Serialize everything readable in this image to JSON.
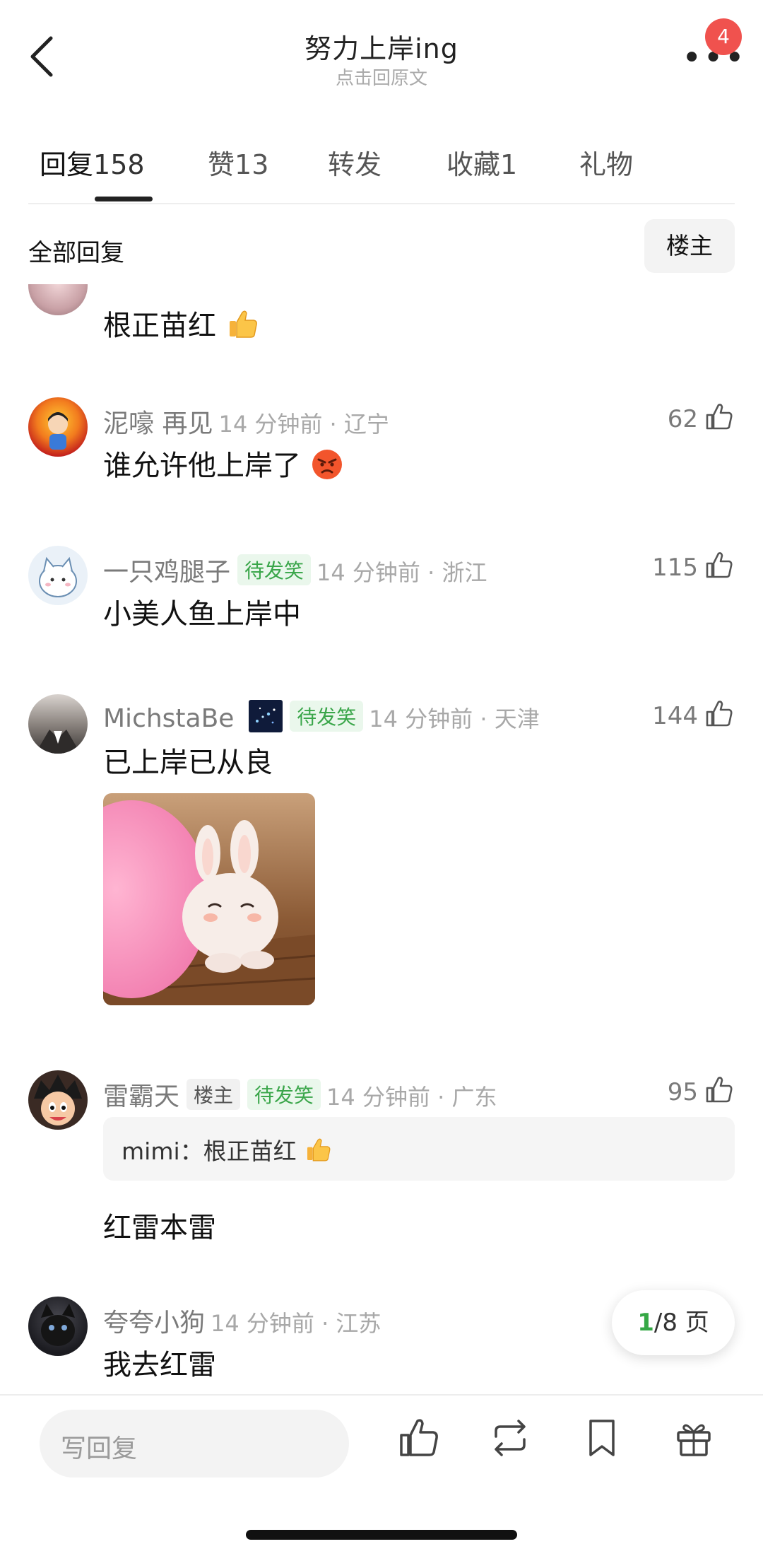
{
  "header": {
    "title": "努力上岸ing",
    "subtitle": "点击回原文",
    "notification_count": "4"
  },
  "tabs": [
    {
      "label": "回复",
      "count": "158"
    },
    {
      "label": "赞",
      "count": "13"
    },
    {
      "label": "转发",
      "count": ""
    },
    {
      "label": "收藏",
      "count": "1"
    },
    {
      "label": "礼物",
      "count": ""
    }
  ],
  "filter": {
    "label": "全部回复",
    "op_button": "楼主"
  },
  "comments": [
    {
      "username": "",
      "time_location": "",
      "text": "根正苗红",
      "emoji": "thumbs-up",
      "likes": ""
    },
    {
      "username": "泥嚎 再见",
      "time_location": "14 分钟前 · 辽宁",
      "text": "谁允许他上岸了",
      "emoji": "angry-face",
      "likes": "62"
    },
    {
      "username": "一只鸡腿子",
      "badge": "待发笑",
      "time_location": "14 分钟前 · 浙江",
      "text": "小美人鱼上岸中",
      "likes": "115"
    },
    {
      "username": "MichstaBe",
      "badge": "待发笑",
      "time_location": "14 分钟前 · 天津",
      "text": "已上岸已从良",
      "likes": "144",
      "image": "bunny-sticker"
    },
    {
      "username": "雷霸天",
      "op_badge": "楼主",
      "badge": "待发笑",
      "time_location": "14 分钟前 · 广东",
      "quote": "mimi：根正苗红",
      "quote_emoji": "thumbs-up",
      "text": "红雷本雷",
      "likes": "95"
    },
    {
      "username": "夸夸小狗",
      "time_location": "14 分钟前 · 江苏",
      "text": "我去红雷",
      "likes": ""
    }
  ],
  "pagination": {
    "current": "1",
    "total_label": "/8 页"
  },
  "bottom_bar": {
    "reply_placeholder": "写回复"
  },
  "colors": {
    "badge_green": "#3aa64a",
    "notification_red": "#f0524e",
    "page_current": "#35a845"
  }
}
